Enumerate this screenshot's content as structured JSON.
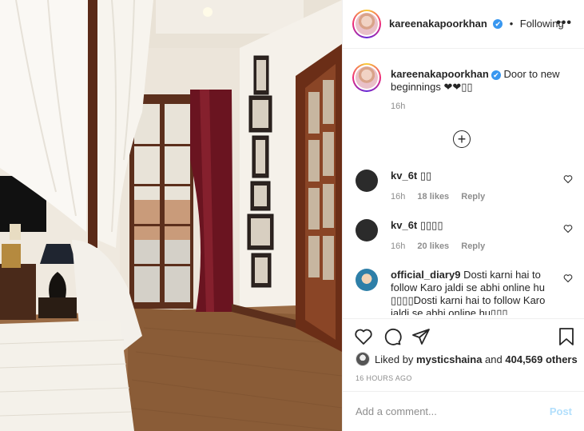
{
  "header": {
    "username": "kareenakapoorkhan",
    "verified_mark": "✔",
    "separator": "•",
    "follow_status": "Following",
    "more_label": "•••"
  },
  "caption": {
    "username": "kareenakapoorkhan",
    "text": "Door to new beginnings ❤❤▯▯",
    "time": "16h"
  },
  "load_more_label": "+",
  "comments": [
    {
      "username": "kv_6t",
      "text": "▯▯",
      "time": "16h",
      "likes": "18 likes",
      "reply": "Reply"
    },
    {
      "username": "kv_6t",
      "text": "▯▯▯▯",
      "time": "16h",
      "likes": "20 likes",
      "reply": "Reply"
    },
    {
      "username": "official_diary9",
      "text": "Dosti karni hai to follow Karo jaldi se abhi online hu ▯▯▯▯Dosti karni hai to follow Karo jaldi se abhi online hu▯▯▯",
      "time": "",
      "likes": "",
      "reply": ""
    }
  ],
  "likes": {
    "prefix": "Liked by",
    "user": "mysticshaina",
    "and": "and",
    "count": "404,569 others"
  },
  "posted_ago": "16 HOURS AGO",
  "add_comment": {
    "placeholder": "Add a comment...",
    "post_label": "Post"
  },
  "colors": {
    "accent_blue": "#3897f0",
    "post_disabled": "#b2dffc",
    "muted_text": "#8e8e8e",
    "divider": "#efefef"
  },
  "icons": [
    "more-icon",
    "verified-icon",
    "load-more-icon",
    "heart-icon",
    "comment-icon",
    "share-icon",
    "bookmark-icon"
  ]
}
